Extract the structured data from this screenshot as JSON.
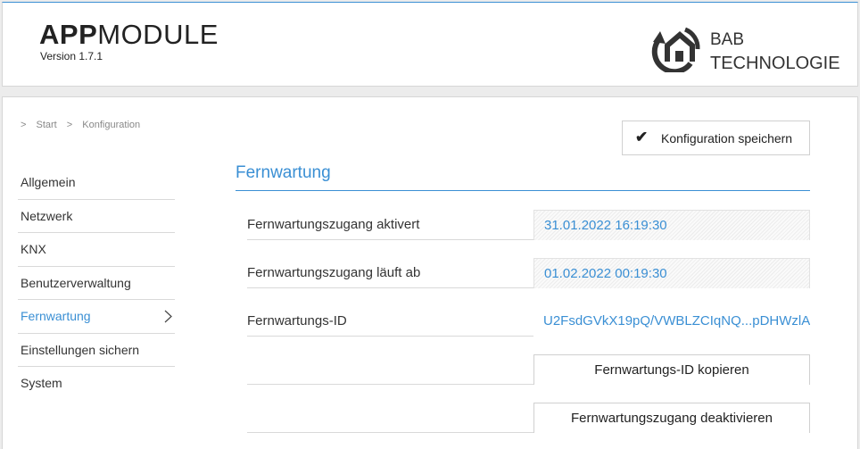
{
  "header": {
    "app_title_bold": "APP",
    "app_title_light": "MODULE",
    "version": "Version 1.7.1",
    "brand_line1": "BAB",
    "brand_line2": "TECHNOLOGIE"
  },
  "breadcrumb": {
    "sep": ">",
    "items": [
      "Start",
      "Konfiguration"
    ]
  },
  "toolbar": {
    "save_label": "Konfiguration speichern"
  },
  "sidebar": {
    "items": [
      {
        "label": "Allgemein"
      },
      {
        "label": "Netzwerk"
      },
      {
        "label": "KNX"
      },
      {
        "label": "Benutzerverwaltung"
      },
      {
        "label": "Fernwartung",
        "active": true
      },
      {
        "label": "Einstellungen sichern"
      },
      {
        "label": "System"
      }
    ]
  },
  "section": {
    "title": "Fernwartung",
    "rows": [
      {
        "label": "Fernwartungszugang aktivert",
        "value": "31.01.2022 16:19:30"
      },
      {
        "label": "Fernwartungszugang läuft ab",
        "value": "01.02.2022 00:19:30"
      },
      {
        "label": "Fernwartungs-ID",
        "value": "U2FsdGVkX19pQ/VWBLZCIqNQ...pDHWzlA"
      }
    ],
    "copy_button": "Fernwartungs-ID kopieren",
    "deactivate_button": "Fernwartungszugang deaktivieren"
  },
  "colors": {
    "accent": "#3a8fd4",
    "text": "#333333"
  },
  "icons": {
    "brand_logo": "bab-house-refresh-logo",
    "save_check": "check-icon",
    "active_chevron": "chevron-right-icon"
  }
}
